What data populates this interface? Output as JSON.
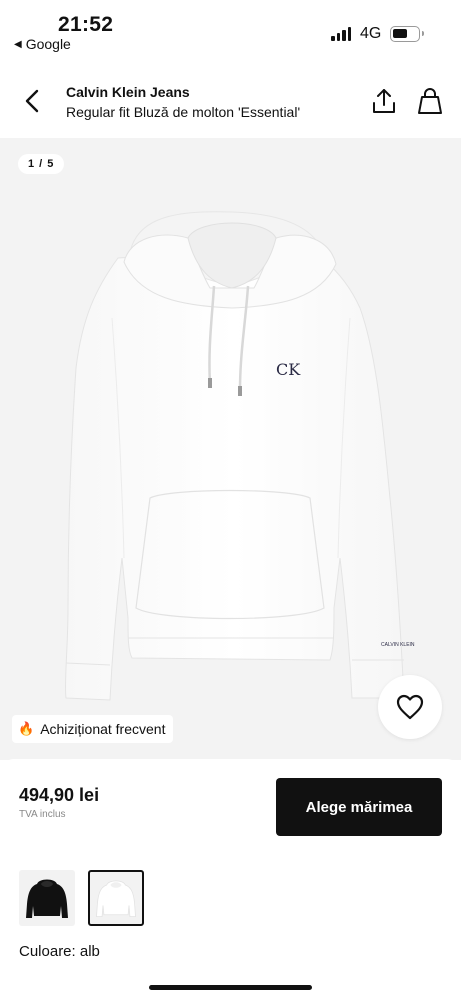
{
  "status_bar": {
    "time": "21:52",
    "back_app": "Google",
    "network": "4G",
    "battery_level": 0.6
  },
  "header": {
    "brand": "Calvin Klein Jeans",
    "product_name": "Regular fit Bluză de molton 'Essential'",
    "icons": [
      "chevron-left-icon",
      "share-icon",
      "shopping-bag-icon"
    ]
  },
  "gallery": {
    "counter": "1 / 5",
    "logo_text": "CK",
    "sleeve_text": "CALVIN KLEIN",
    "badge_text": "Achiziționat frecvent",
    "badge_icon": "flame-icon"
  },
  "purchase": {
    "price": "494,90 lei",
    "vat_note": "TVA inclus",
    "cta_label": "Alege mărimea",
    "color_label": "Culoare: alb",
    "swatches": [
      {
        "color_name": "negru",
        "hex": "#111111",
        "selected": false
      },
      {
        "color_name": "alb",
        "hex": "#ffffff",
        "selected": true
      }
    ]
  },
  "colors": {
    "accent": "#111111",
    "gallery_bg": "#f3f3f3",
    "flame": "#ff5a1f"
  }
}
